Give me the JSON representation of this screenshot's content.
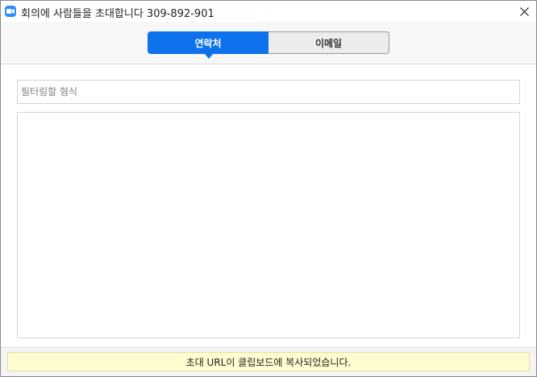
{
  "window": {
    "title": "회의에 사람들을 초대합니다 309-892-901",
    "app_icon": "zoom-video-icon",
    "close_icon": "close-icon"
  },
  "tabs": [
    {
      "label": "연락처",
      "active": true
    },
    {
      "label": "이메일",
      "active": false
    }
  ],
  "filter": {
    "placeholder": "필터링할 형식",
    "value": ""
  },
  "contacts": [],
  "status": {
    "message": "초대 URL이 클립보드에 복사되었습니다."
  },
  "colors": {
    "accent": "#0e72ed",
    "status_bg": "#fffccf"
  }
}
